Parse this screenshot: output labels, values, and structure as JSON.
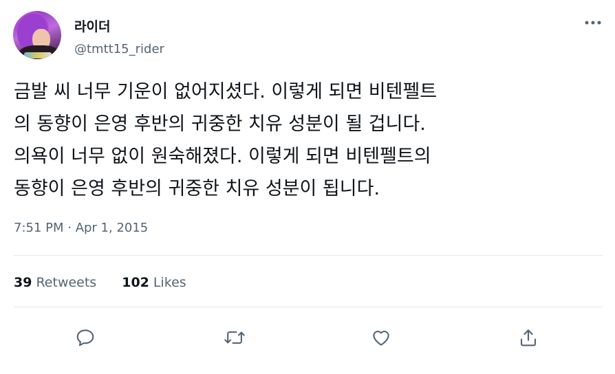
{
  "user": {
    "display_name": "라이더",
    "handle": "@tmtt15_rider"
  },
  "tweet": {
    "text": "금발 씨 너무 기운이 없어지셨다. 이렇게 되면 비텐펠트\n의 동향이 은영 후반의 귀중한 치유 성분이 될 겁니다.\n의욕이 너무 없이 원숙해졌다. 이렇게 되면 비텐펠트의\n동향이 은영 후반의 귀중한 치유 성분이 됩니다.",
    "timestamp": "7:51 PM · Apr 1, 2015"
  },
  "stats": {
    "retweets_count": "39",
    "retweets_label": "Retweets",
    "likes_count": "102",
    "likes_label": "Likes"
  },
  "actions": {
    "reply_icon": "reply-icon",
    "retweet_icon": "retweet-icon",
    "like_icon": "like-icon",
    "share_icon": "share-icon"
  },
  "colors": {
    "text_primary": "#0f1419",
    "text_secondary": "#536471",
    "divider": "#e1e8ed"
  }
}
